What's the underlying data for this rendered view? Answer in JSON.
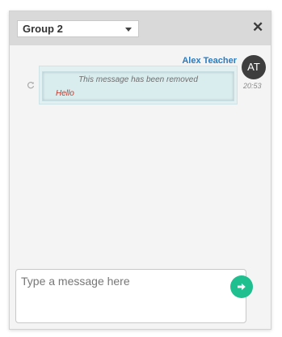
{
  "header": {
    "group_select": {
      "selected": "Group 2"
    },
    "close_label": "✕"
  },
  "messages": [
    {
      "sender": "Alex Teacher",
      "avatar_initials": "AT",
      "time": "20:53",
      "removed_notice": "This message has been removed",
      "original_text": "Hello"
    }
  ],
  "composer": {
    "placeholder": "Type a message here",
    "value": ""
  },
  "colors": {
    "accent_name": "#2b7bbf",
    "send_button": "#1fbf8f",
    "removed_original": "#c0392b",
    "avatar_bg": "#3e3e3e"
  },
  "icons": {
    "dropdown": "chevron-down-icon",
    "close": "close-icon",
    "retry": "refresh-icon",
    "send": "arrow-right-icon"
  }
}
